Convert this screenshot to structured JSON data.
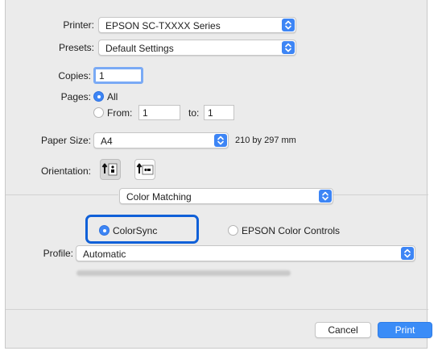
{
  "printer": {
    "label": "Printer:",
    "value": "EPSON SC-TXXXX Series"
  },
  "presets": {
    "label": "Presets:",
    "value": "Default Settings"
  },
  "copies": {
    "label": "Copies:",
    "value": "1"
  },
  "pages": {
    "label": "Pages:",
    "all_label": "All",
    "from_label": "From:",
    "from_value": "1",
    "to_label": "to:",
    "to_value": "1",
    "selected": "All"
  },
  "paper_size": {
    "label": "Paper Size:",
    "value": "A4",
    "dimensions": "210 by 297 mm"
  },
  "orientation": {
    "label": "Orientation:",
    "selected": "portrait"
  },
  "section_popup": {
    "value": "Color Matching"
  },
  "color_mode": {
    "options": [
      "ColorSync",
      "EPSON Color Controls"
    ],
    "selected": "ColorSync"
  },
  "profile": {
    "label": "Profile:",
    "value": "Automatic"
  },
  "buttons": {
    "cancel": "Cancel",
    "print": "Print"
  },
  "colors": {
    "accent": "#3d85f5",
    "focus_ring": "#1060d8",
    "background": "#ebebeb"
  }
}
